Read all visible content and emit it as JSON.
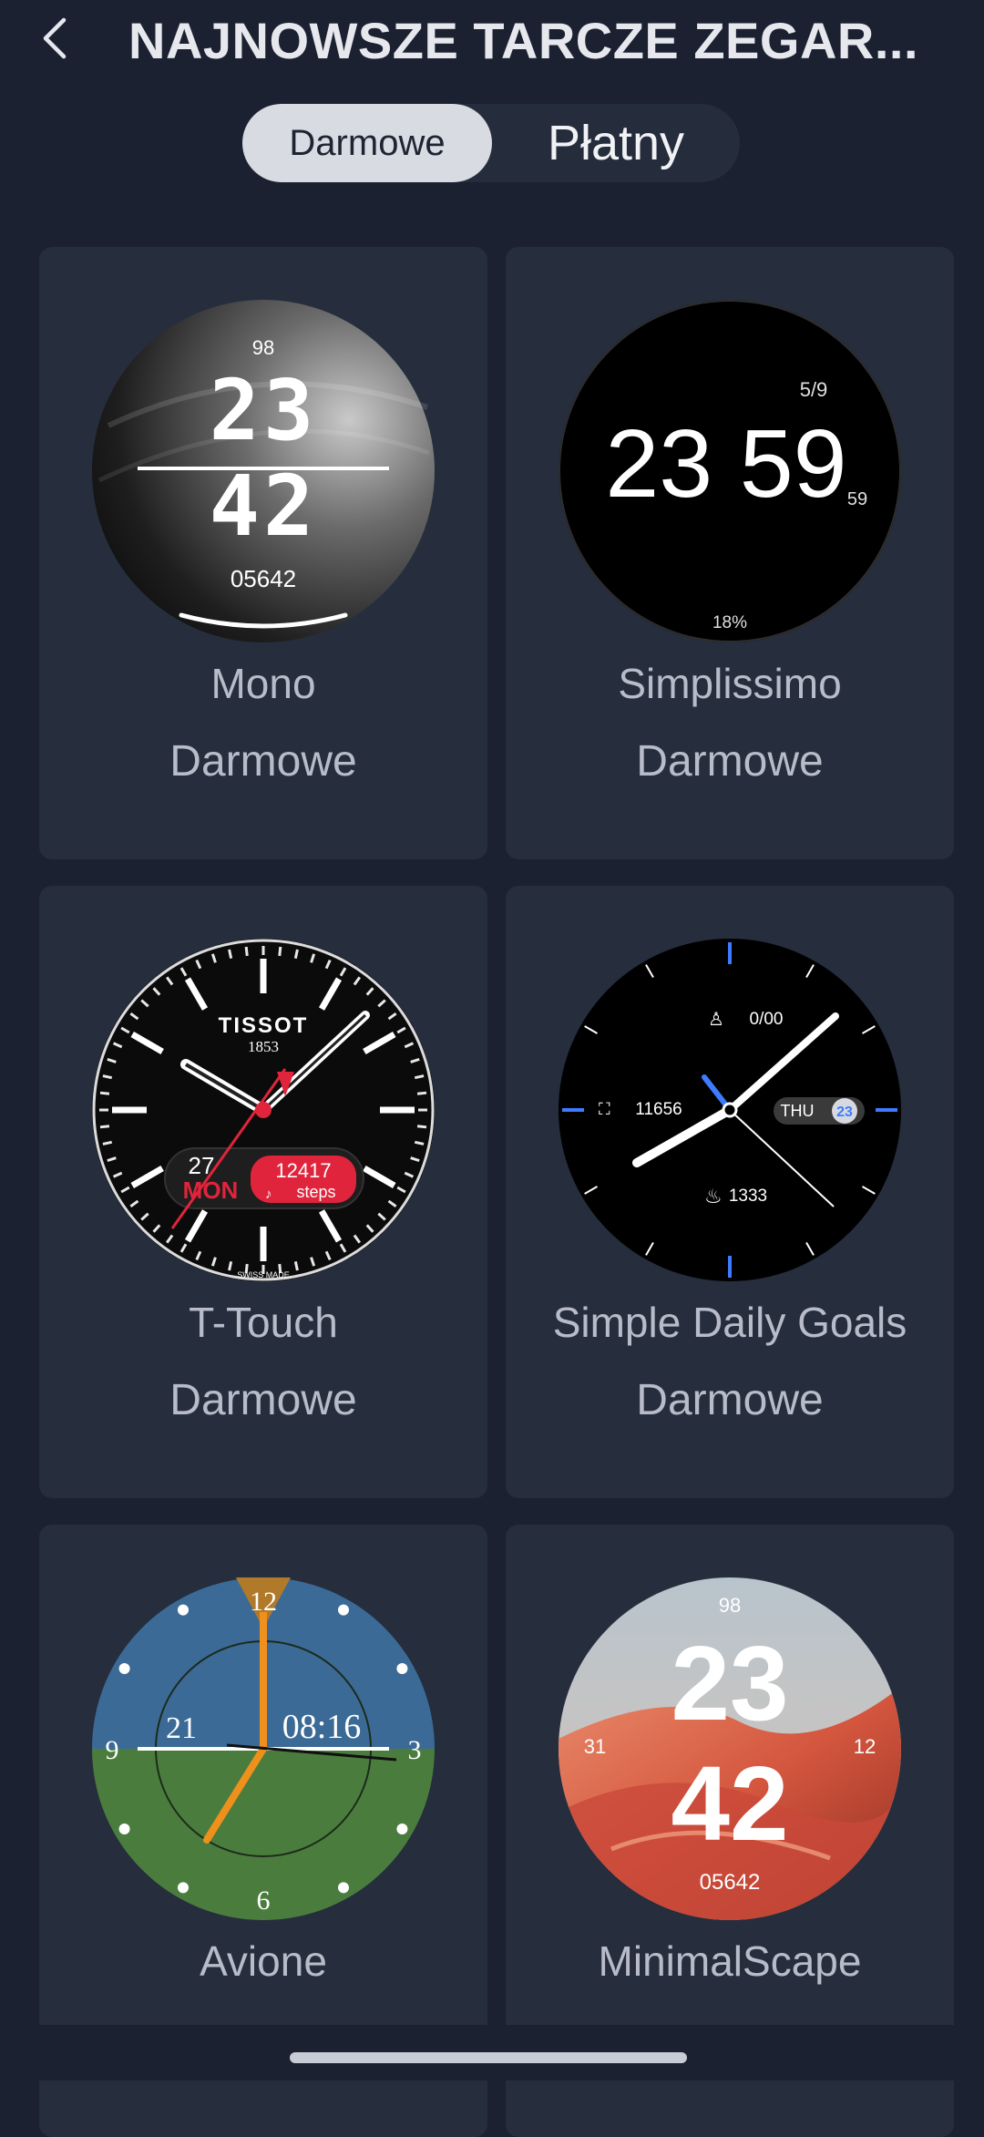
{
  "header": {
    "title": "NAJNOWSZE TARCZE ZEGAR...",
    "back_icon": "chevron-left-icon"
  },
  "tabs": [
    {
      "label": "Darmowe",
      "selected": true
    },
    {
      "label": "Płatny",
      "selected": false
    }
  ],
  "faces": [
    {
      "name": "Mono",
      "price": "Darmowe",
      "preview": {
        "top": "98",
        "hour": "23",
        "minute": "42",
        "bottom": "05642"
      }
    },
    {
      "name": "Simplissimo",
      "price": "Darmowe",
      "preview": {
        "date": "5/9",
        "time": "23 59",
        "seconds": "59",
        "battery": "18%"
      }
    },
    {
      "name": "T-Touch",
      "price": "Darmowe",
      "preview": {
        "brand": "TISSOT",
        "year": "1853",
        "day": "27",
        "weekday": "MON",
        "steps": "12417",
        "steps_label": "steps",
        "footer": "SWISS MADE"
      }
    },
    {
      "name": "Simple Daily Goals",
      "price": "Darmowe",
      "preview": {
        "goal": "0/00",
        "steps": "11656",
        "weekday": "THU",
        "date": "23",
        "calories": "1333"
      }
    },
    {
      "name": "Avione",
      "price": "",
      "preview": {
        "n12": "12",
        "n3": "3",
        "n6": "6",
        "n9": "9",
        "date": "21",
        "time": "08:16"
      }
    },
    {
      "name": "MinimalScape",
      "price": "",
      "preview": {
        "top": "98",
        "hour": "23",
        "minute": "42",
        "left": "31",
        "right": "12",
        "bottom": "05642"
      }
    }
  ],
  "colors": {
    "background": "#1b2130",
    "card": "#262d3c",
    "accent_red": "#e0243c",
    "accent_blue": "#3d7bff",
    "accent_orange": "#f0901c"
  }
}
